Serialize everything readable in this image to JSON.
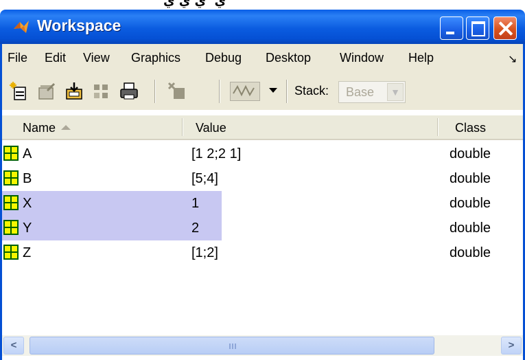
{
  "window": {
    "title": "Workspace",
    "buttons": {
      "minimize": "minimize-icon",
      "maximize": "maximize-icon",
      "close": "close-icon"
    }
  },
  "menu": {
    "items": [
      "File",
      "Edit",
      "View",
      "Graphics",
      "Debug",
      "Desktop",
      "Window",
      "Help"
    ],
    "overflow": "↘"
  },
  "toolbar": {
    "icons": [
      "new-variable-icon",
      "open-variable-icon",
      "import-data-icon",
      "save-icon",
      "print-icon",
      "delete-icon",
      "plot-icon"
    ],
    "stack_label": "Stack:",
    "stack_value": "Base"
  },
  "table": {
    "columns": {
      "name": "Name",
      "value": "Value",
      "class": "Class"
    },
    "sort": "name-ascending",
    "rows": [
      {
        "name": "A",
        "value": "[1 2;2 1]",
        "class": "double",
        "selected": false
      },
      {
        "name": "B",
        "value": "[5;4]",
        "class": "double",
        "selected": false
      },
      {
        "name": "X",
        "value": "1",
        "class": "double",
        "selected": true
      },
      {
        "name": "Y",
        "value": "2",
        "class": "double",
        "selected": true
      },
      {
        "name": "Z",
        "value": "[1;2]",
        "class": "double",
        "selected": false
      }
    ]
  },
  "colors": {
    "titlebar": "#0550d4",
    "selection": "#c8c8f2",
    "chrome": "#ece9d8"
  }
}
